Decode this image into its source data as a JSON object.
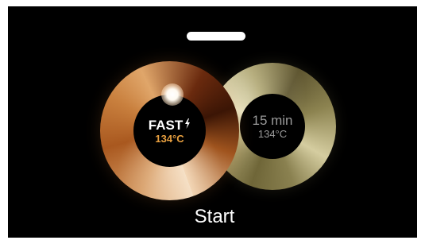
{
  "modes": {
    "fast": {
      "label": "FAST",
      "icon": "lightning-bolt-icon",
      "temperature": "134°C",
      "selected": true
    },
    "standard": {
      "label": "15 min",
      "temperature": "134°C",
      "selected": false
    }
  },
  "actions": {
    "start_label": "Start"
  },
  "colors": {
    "background": "#000000",
    "fast_temp_accent": "#e8a040",
    "inactive_text": "#9a9a9a"
  }
}
